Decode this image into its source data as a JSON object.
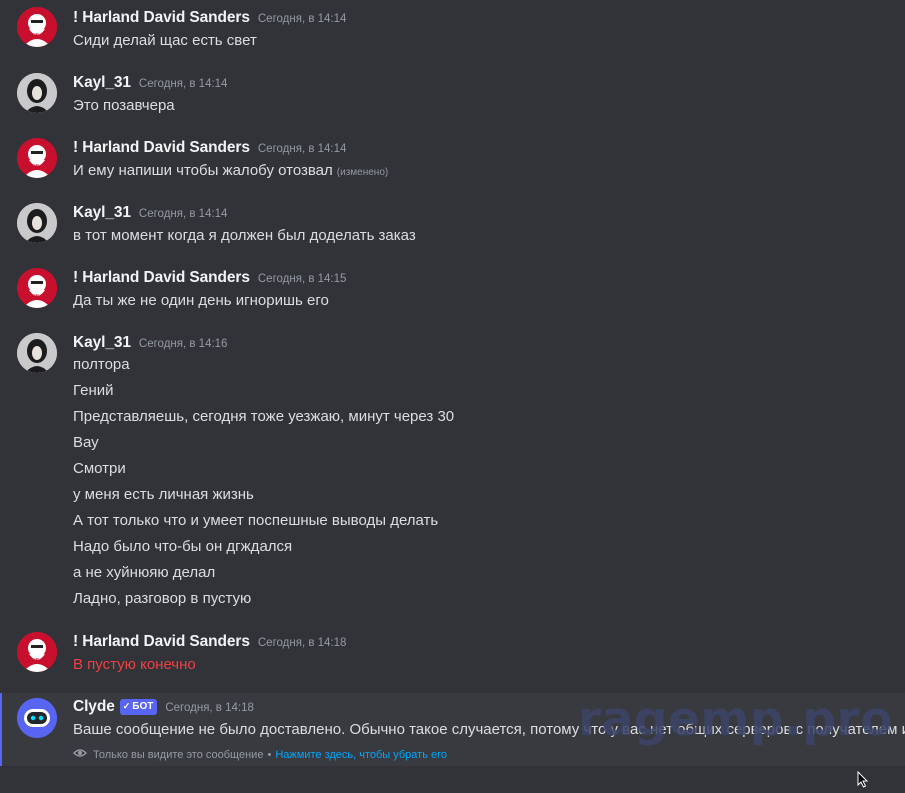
{
  "colors": {
    "background": "#313338",
    "author": "#f2f3f5",
    "message_text": "#dbdee1",
    "timestamp": "#949ba4",
    "error_text": "#f23f42",
    "bot_badge": "#5865f2",
    "link": "#00a8fc"
  },
  "messages": [
    {
      "author": "! Harland David Sanders",
      "timestamp": "Сегодня, в 14:14",
      "avatar": "kfc-colonel-avatar",
      "lines": [
        "Сиди делай щас есть свет"
      ]
    },
    {
      "author": "Kayl_31",
      "timestamp": "Сегодня, в 14:14",
      "avatar": "girl-avatar",
      "lines": [
        "Это позавчера"
      ]
    },
    {
      "author": "! Harland David Sanders",
      "timestamp": "Сегодня, в 14:14",
      "avatar": "kfc-colonel-avatar",
      "lines": [
        "И ему напиши чтобы жалобу отозвал"
      ],
      "edited": "(изменено)"
    },
    {
      "author": "Kayl_31",
      "timestamp": "Сегодня, в 14:14",
      "avatar": "girl-avatar",
      "lines": [
        "в тот момент когда я должен был доделать заказ"
      ]
    },
    {
      "author": "! Harland David Sanders",
      "timestamp": "Сегодня, в 14:15",
      "avatar": "kfc-colonel-avatar",
      "lines": [
        "Да ты же не один день игноришь его"
      ]
    },
    {
      "author": "Kayl_31",
      "timestamp": "Сегодня, в 14:16",
      "avatar": "girl-avatar",
      "lines": [
        "полтора",
        "Гений",
        "Представляешь, сегодня тоже уезжаю, минут через 30",
        "Вау",
        "Смотри",
        "у меня есть личная жизнь",
        "А тот только что и умеет поспешные выводы делать",
        "Надо было что-бы он дгждался",
        "а не хуйнюяю делал",
        "Ладно, разговор в пустую"
      ]
    },
    {
      "author": "! Harland David Sanders",
      "timestamp": "Сегодня, в 14:18",
      "avatar": "kfc-colonel-avatar",
      "lines": [
        "В пустую конечно"
      ],
      "failed": true
    }
  ],
  "clyde": {
    "author": "Clyde",
    "badge": "БОТ",
    "timestamp": "Сегодня, в 14:18",
    "text": "Ваше сообщение не было доставлено. Обычно такое случается, потому что у вас нет общих серверов с получателем ил",
    "visibility_note": "Только вы видите это сообщение",
    "separator": "•",
    "dismiss_link": "Нажмите здесь, чтобы убрать его"
  },
  "watermark": "ragemp.pro"
}
